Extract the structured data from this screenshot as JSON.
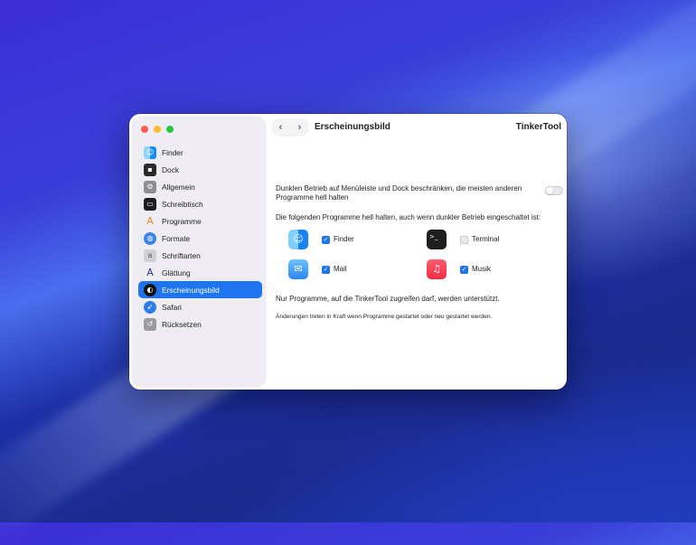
{
  "app_title": "TinkerTool",
  "page_title": "Erscheinungsbild",
  "nav": {
    "back_icon": "‹",
    "forward_icon": "›"
  },
  "colors": {
    "accent": "#1f74f0",
    "close": "#ff5f57",
    "minimize": "#febc2e",
    "zoom": "#28c840"
  },
  "sidebar": {
    "items": [
      {
        "label": "Finder",
        "icon": "finder-icon",
        "selected": false
      },
      {
        "label": "Dock",
        "icon": "dock-icon",
        "selected": false
      },
      {
        "label": "Allgemein",
        "icon": "general-icon",
        "selected": false
      },
      {
        "label": "Schreibtisch",
        "icon": "desktop-icon",
        "selected": false
      },
      {
        "label": "Programme",
        "icon": "applications-icon",
        "selected": false
      },
      {
        "label": "Formate",
        "icon": "globe-icon",
        "selected": false
      },
      {
        "label": "Schriftarten",
        "icon": "font-icon",
        "selected": false
      },
      {
        "label": "Glättung",
        "icon": "smoothing-icon",
        "selected": false
      },
      {
        "label": "Erscheinungsbild",
        "icon": "appearance-icon",
        "selected": true
      },
      {
        "label": "Safari",
        "icon": "safari-icon",
        "selected": false
      },
      {
        "label": "Rücksetzen",
        "icon": "reset-icon",
        "selected": false
      }
    ]
  },
  "content": {
    "dark_mode_restrict_label": "Dunklen Betrieb auf Menüleiste und Dock beschränken, die meisten anderen Programme hell halten",
    "dark_mode_restrict_on": false,
    "keep_light_intro": "Die folgenden Programme hell halten, auch wenn dunkler Betrieb eingeschaltet ist:",
    "apps": [
      {
        "name": "Finder",
        "checked": true,
        "icon": "finder-icon"
      },
      {
        "name": "Terminal",
        "checked": false,
        "icon": "terminal-icon"
      },
      {
        "name": "Mail",
        "checked": true,
        "icon": "mail-icon"
      },
      {
        "name": "Musik",
        "checked": true,
        "icon": "music-icon"
      }
    ],
    "supported_note": "Nur Programme, auf die TinkerTool zugreifen darf, werden unterstützt.",
    "restart_note": "Änderungen treten in Kraft wenn Programme gestartet oder neu gestartet werden."
  }
}
